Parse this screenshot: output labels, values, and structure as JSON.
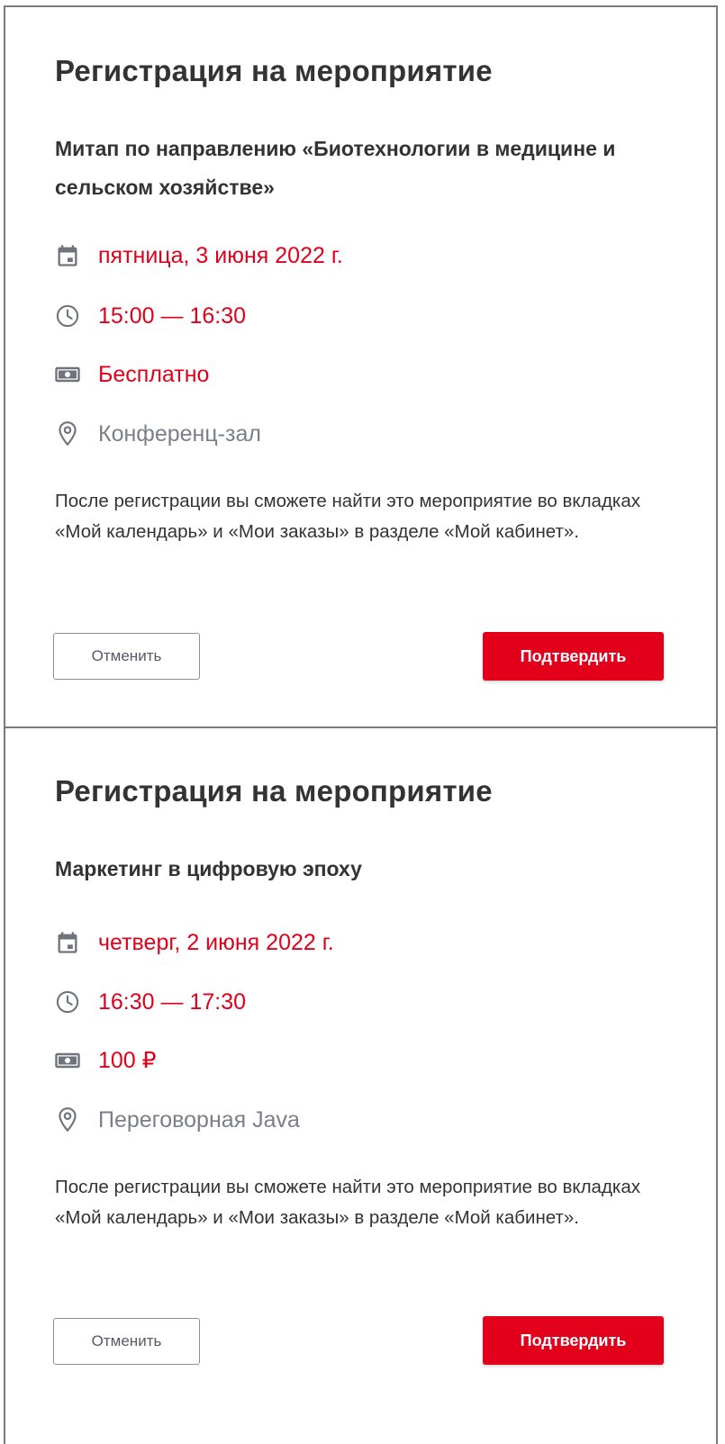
{
  "colors": {
    "accent": "#e3001b",
    "text": "#333333",
    "muted": "#7b7f88",
    "icon": "#6f747c"
  },
  "dialogs": [
    {
      "title": "Регистрация на мероприятие",
      "event_name": "Митап по направлению «Биотехнологии в медицине и сельском хозяйстве»",
      "date": {
        "icon": "calendar-icon",
        "text": "пятница, 3 июня 2022 г."
      },
      "time": {
        "icon": "clock-icon",
        "text": "15:00 — 16:30"
      },
      "price": {
        "icon": "money-icon",
        "text": "Бесплатно"
      },
      "location": {
        "icon": "location-pin-icon",
        "text": "Конференц-зал"
      },
      "note": "После регистрации вы сможете найти это мероприятие во вкладках «Мой календарь» и «Мои заказы» в разделе «Мой кабинет».",
      "cancel_label": "Отменить",
      "confirm_label": "Подтвердить"
    },
    {
      "title": "Регистрация на мероприятие",
      "event_name": "Маркетинг в цифровую эпоху",
      "date": {
        "icon": "calendar-icon",
        "text": "четверг, 2 июня 2022 г."
      },
      "time": {
        "icon": "clock-icon",
        "text": "16:30 — 17:30"
      },
      "price": {
        "icon": "money-icon",
        "text": "100 ₽"
      },
      "location": {
        "icon": "location-pin-icon",
        "text": "Переговорная Java"
      },
      "note": "После регистрации вы сможете найти это мероприятие во вкладках «Мой календарь» и «Мои заказы» в разделе «Мой кабинет».",
      "cancel_label": "Отменить",
      "confirm_label": "Подтвердить"
    }
  ]
}
